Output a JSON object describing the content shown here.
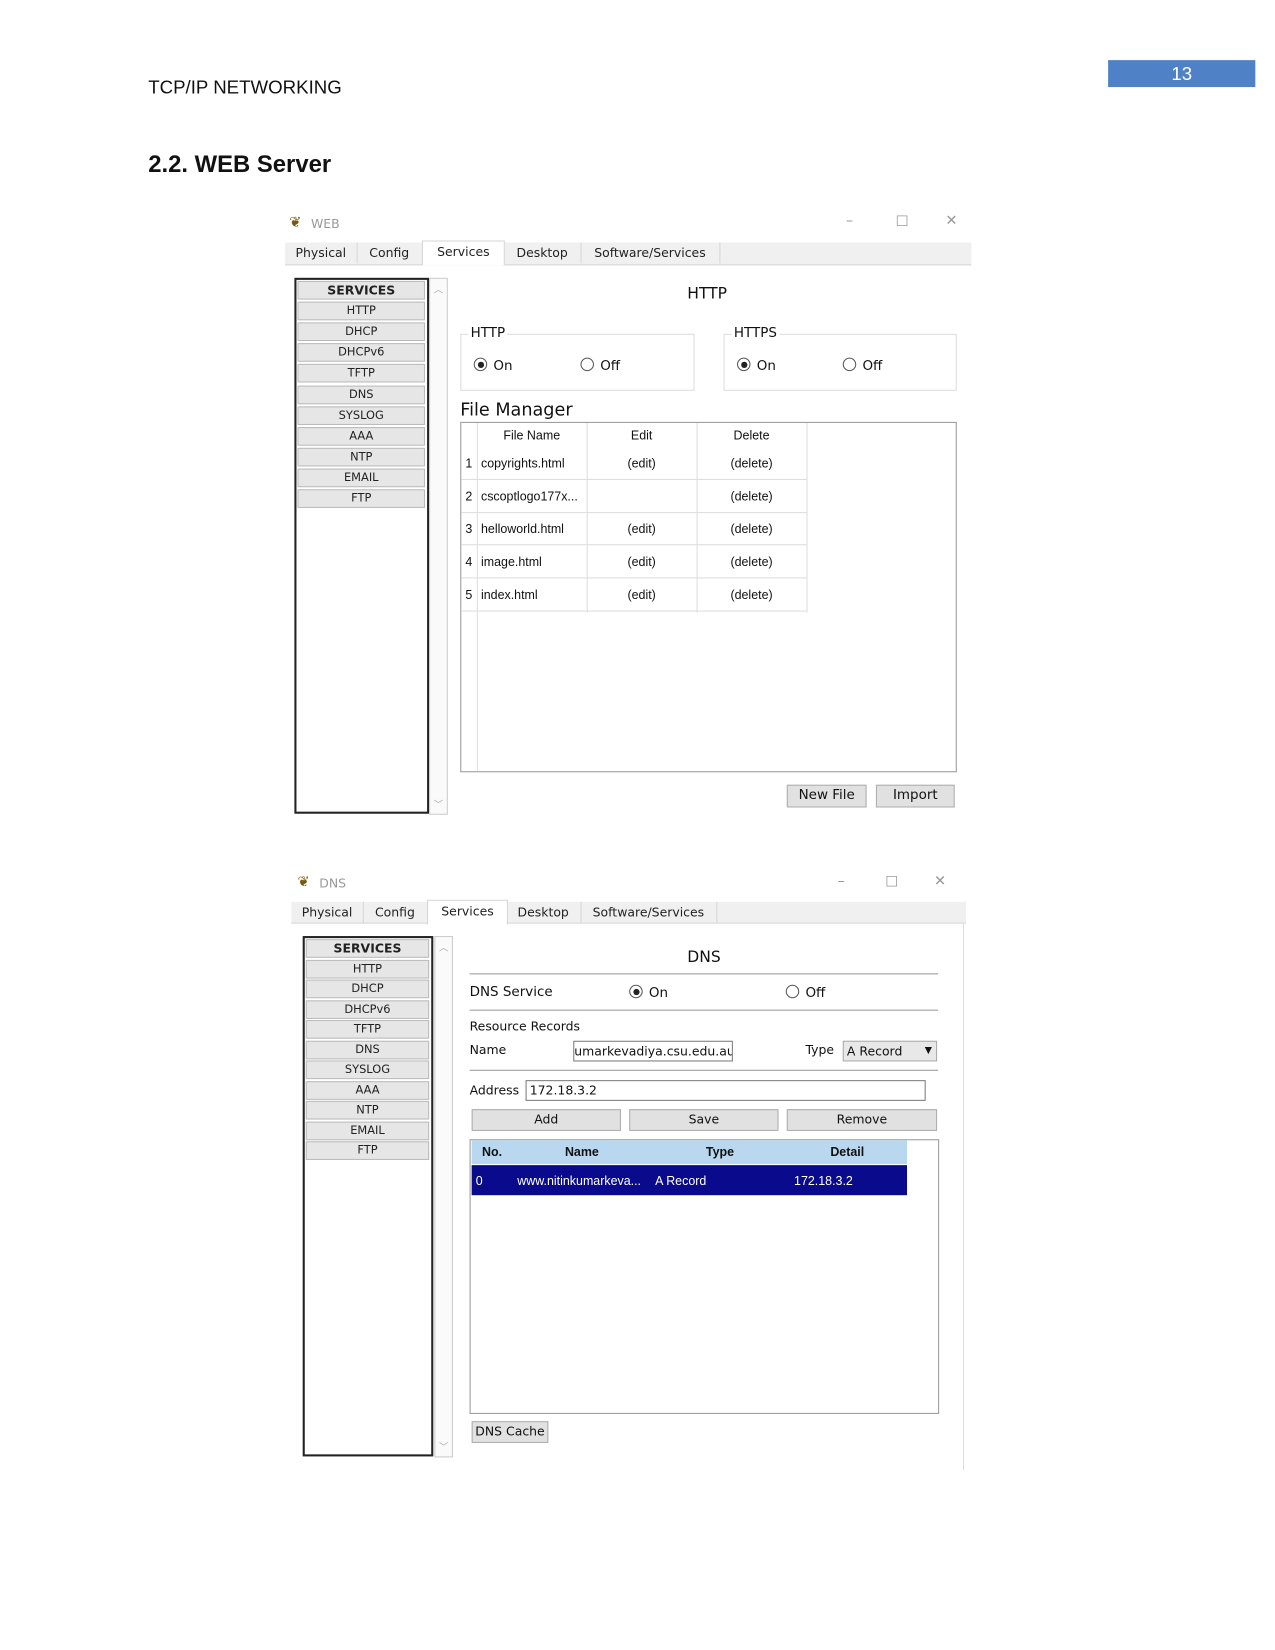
{
  "document": {
    "header": "TCP/IP NETWORKING",
    "page_number": "13",
    "heading": "2.2. WEB Server"
  },
  "web_window": {
    "title": "WEB",
    "tabs": [
      "Physical",
      "Config",
      "Services",
      "Desktop",
      "Software/Services"
    ],
    "active_tab": "Services",
    "services": [
      "SERVICES",
      "HTTP",
      "DHCP",
      "DHCPv6",
      "TFTP",
      "DNS",
      "SYSLOG",
      "AAA",
      "NTP",
      "EMAIL",
      "FTP"
    ],
    "panel_title": "HTTP",
    "http": {
      "label": "HTTP",
      "on": "On",
      "off": "Off",
      "selected": "On"
    },
    "https": {
      "label": "HTTPS",
      "on": "On",
      "off": "Off",
      "selected": "On"
    },
    "file_manager": {
      "title": "File Manager",
      "columns": [
        "File Name",
        "Edit",
        "Delete"
      ],
      "rows": [
        {
          "n": "1",
          "name": "copyrights.html",
          "edit": "(edit)",
          "delete": "(delete)"
        },
        {
          "n": "2",
          "name": "cscoptlogo177x...",
          "edit": "",
          "delete": "(delete)"
        },
        {
          "n": "3",
          "name": "helloworld.html",
          "edit": "(edit)",
          "delete": "(delete)"
        },
        {
          "n": "4",
          "name": "image.html",
          "edit": "(edit)",
          "delete": "(delete)"
        },
        {
          "n": "5",
          "name": "index.html",
          "edit": "(edit)",
          "delete": "(delete)"
        }
      ]
    },
    "buttons": {
      "new_file": "New File",
      "import": "Import"
    }
  },
  "dns_window": {
    "title": "DNS",
    "tabs": [
      "Physical",
      "Config",
      "Services",
      "Desktop",
      "Software/Services"
    ],
    "active_tab": "Services",
    "services": [
      "SERVICES",
      "HTTP",
      "DHCP",
      "DHCPv6",
      "TFTP",
      "DNS",
      "SYSLOG",
      "AAA",
      "NTP",
      "EMAIL",
      "FTP"
    ],
    "panel_title": "DNS",
    "dns_service": {
      "label": "DNS Service",
      "on": "On",
      "off": "Off",
      "selected": "On"
    },
    "resource_records": "Resource Records",
    "name_label": "Name",
    "name_value": "umarkevadiya.csu.edu.au",
    "type_label": "Type",
    "type_value": "A Record",
    "address_label": "Address",
    "address_value": "172.18.3.2",
    "buttons": {
      "add": "Add",
      "save": "Save",
      "remove": "Remove",
      "dns_cache": "DNS Cache"
    },
    "table": {
      "columns": [
        "No.",
        "Name",
        "Type",
        "Detail"
      ],
      "rows": [
        {
          "no": "0",
          "name": "www.nitinkumarkeva...",
          "type": "A Record",
          "detail": "172.18.3.2"
        }
      ]
    },
    "colors": {
      "header_bg": "#b9d7ef",
      "selected_row_bg": "#0a0a8c"
    }
  }
}
